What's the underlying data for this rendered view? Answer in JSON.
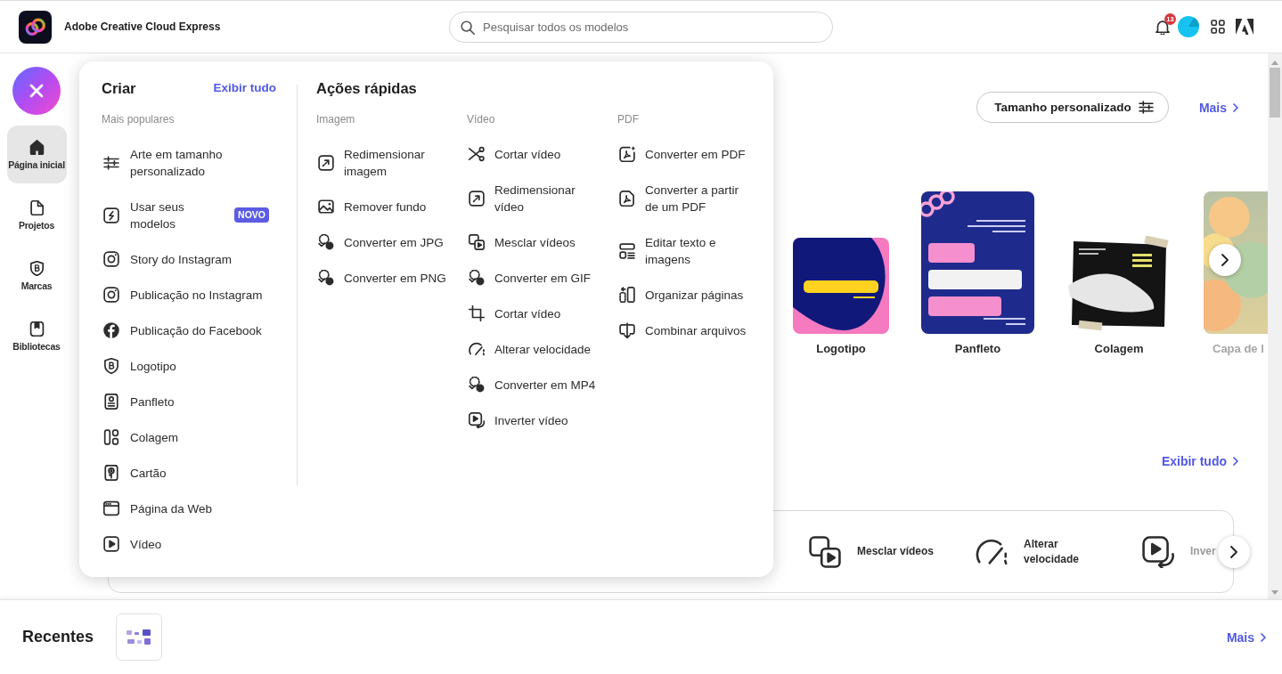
{
  "header": {
    "app_name": "Adobe Creative Cloud Express",
    "search": {
      "placeholder": "Pesquisar todos os modelos"
    },
    "notification_count": "13"
  },
  "sidebar": {
    "items": [
      {
        "label": "Página inicial",
        "selected": true
      },
      {
        "label": "Projetos",
        "selected": false
      },
      {
        "label": "Marcas",
        "selected": false
      },
      {
        "label": "Bibliotecas",
        "selected": false
      }
    ]
  },
  "create_menu": {
    "create": {
      "title": "Criar",
      "view_all_link": "Exibir tudo",
      "heading": "Mais populares",
      "items": [
        {
          "label": "Arte em tamanho personalizado"
        },
        {
          "label": "Usar seus modelos",
          "badge": "NOVO"
        },
        {
          "label": "Story do Instagram"
        },
        {
          "label": "Publicação no Instagram"
        },
        {
          "label": "Publicação do Facebook"
        },
        {
          "label": "Logotipo"
        },
        {
          "label": "Panfleto"
        },
        {
          "label": "Colagem"
        },
        {
          "label": "Cartão"
        },
        {
          "label": "Página da Web"
        },
        {
          "label": "Vídeo"
        }
      ]
    },
    "quick_actions": {
      "title": "Ações rápidas",
      "columns": [
        {
          "heading": "Imagem",
          "items": [
            "Redimensionar imagem",
            "Remover fundo",
            "Converter em JPG",
            "Converter em PNG"
          ]
        },
        {
          "heading": "Vídeo",
          "items": [
            "Cortar vídeo",
            "Redimensionar vídeo",
            "Mesclar vídeos",
            "Converter em GIF",
            "Cortar vídeo",
            "Alterar velocidade",
            "Converter em MP4",
            "Inverter vídeo"
          ]
        },
        {
          "heading": "PDF",
          "items": [
            "Converter em PDF",
            "Converter a partir de um PDF",
            "Editar texto e imagens",
            "Organizar páginas",
            "Combinar arquivos"
          ]
        }
      ]
    }
  },
  "main": {
    "custom_size_button": "Tamanho personalizado",
    "more_link": "Mais",
    "templates": [
      {
        "label": "Logotipo"
      },
      {
        "label": "Panfleto"
      },
      {
        "label": "Colagem"
      },
      {
        "label": "Capa de l"
      }
    ],
    "view_all_link": "Exibir tudo",
    "quick_actions": [
      {
        "label": "Mesclar vídeos"
      },
      {
        "label": "Alterar velocidade"
      },
      {
        "label": "Inver"
      }
    ]
  },
  "recents": {
    "title": "Recentes",
    "more_link": "Mais"
  }
}
